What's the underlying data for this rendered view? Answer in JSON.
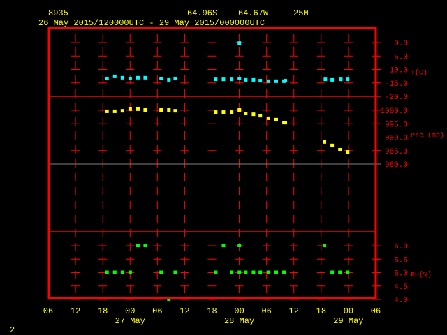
{
  "header": {
    "station": "8935",
    "lat": "64.96S",
    "lon": "64.67W",
    "elev": "25M",
    "period": "26 May 2015/120000UTC - 29 May 2015/000000UTC"
  },
  "page_number": "2",
  "colors": {
    "frame": "#ff0000",
    "text": "#ffff00",
    "temp": "#00ffff",
    "pres": "#ffff00",
    "rh": "#00ff00",
    "midline": "#808080"
  },
  "chart_data": {
    "type": "scatter",
    "x_unit": "hours since 26 May 06Z",
    "xlim": [
      0,
      72
    ],
    "x_tick_labels": [
      "06",
      "12",
      "18",
      "00",
      "06",
      "12",
      "18",
      "00",
      "06",
      "12",
      "18",
      "00",
      "06"
    ],
    "day_labels": [
      {
        "hour": 18,
        "label": "27 May"
      },
      {
        "hour": 42,
        "label": "28 May"
      },
      {
        "hour": 66,
        "label": "29 May"
      }
    ],
    "panels": [
      {
        "name": "temperature",
        "label": "T(C)",
        "ylim": [
          -20,
          0
        ],
        "ticks": [
          "0.0",
          "-5.0",
          "-10.0",
          "-15.0",
          "-20.0"
        ],
        "tick_values": [
          0,
          -5,
          -10,
          -15,
          -20
        ],
        "points": [
          [
            13,
            -13.5
          ],
          [
            14.7,
            -12.7
          ],
          [
            16.4,
            -13.2
          ],
          [
            18.1,
            -13.5
          ],
          [
            19.8,
            -13.2
          ],
          [
            21.4,
            -13.2
          ],
          [
            24.9,
            -13.5
          ],
          [
            26.6,
            -14
          ],
          [
            28,
            -13.5
          ],
          [
            36.9,
            -13.8
          ],
          [
            38.6,
            -13.8
          ],
          [
            40.4,
            -13.8
          ],
          [
            42.1,
            -13.5
          ],
          [
            42.1,
            -0.3
          ],
          [
            43.5,
            -14
          ],
          [
            45.2,
            -14
          ],
          [
            46.7,
            -14.3
          ],
          [
            48.5,
            -14.5
          ],
          [
            50.2,
            -14.5
          ],
          [
            51.9,
            -14.5
          ],
          [
            52.2,
            -14.3
          ],
          [
            61,
            -13.8
          ],
          [
            62.5,
            -14
          ],
          [
            64.4,
            -13.8
          ],
          [
            65.9,
            -13.8
          ]
        ]
      },
      {
        "name": "pressure",
        "label": "Pre (mb)",
        "ylim": [
          980,
          1000
        ],
        "ticks": [
          "1000.0",
          "995.0",
          "990.0",
          "985.0",
          "980.0"
        ],
        "tick_values": [
          1000,
          995,
          990,
          985,
          980
        ],
        "points": [
          [
            13,
            999.5
          ],
          [
            14.7,
            999.5
          ],
          [
            16.4,
            999.7
          ],
          [
            18.1,
            1000.3
          ],
          [
            19.8,
            1000.3
          ],
          [
            21.4,
            1000
          ],
          [
            24.9,
            1000
          ],
          [
            26.6,
            1000
          ],
          [
            28,
            999.7
          ],
          [
            36.9,
            999.2
          ],
          [
            38.6,
            999.2
          ],
          [
            40.4,
            999.2
          ],
          [
            42.1,
            1000
          ],
          [
            43.5,
            998.7
          ],
          [
            45.2,
            998.4
          ],
          [
            46.7,
            997.9
          ],
          [
            48.5,
            996.9
          ],
          [
            50.2,
            996.4
          ],
          [
            51.9,
            995.3
          ],
          [
            52.2,
            995.3
          ],
          [
            60.8,
            988.1
          ],
          [
            62.5,
            986.8
          ],
          [
            64.2,
            985.2
          ],
          [
            65.9,
            984.4
          ]
        ]
      },
      {
        "name": "rh",
        "label": "RH(%)",
        "ylim": [
          4,
          6
        ],
        "ticks": [
          "6.0",
          "5.5",
          "5.0",
          "4.5",
          "4.0"
        ],
        "tick_values": [
          6,
          5.5,
          5,
          4.5,
          4
        ],
        "points": [
          [
            13,
            5
          ],
          [
            14.7,
            5
          ],
          [
            16.4,
            5
          ],
          [
            18.1,
            5
          ],
          [
            19.8,
            6
          ],
          [
            21.4,
            6
          ],
          [
            24.9,
            5
          ],
          [
            26.6,
            4
          ],
          [
            28,
            5
          ],
          [
            36.9,
            5
          ],
          [
            38.6,
            6
          ],
          [
            40.4,
            5
          ],
          [
            42.1,
            6
          ],
          [
            42.1,
            5
          ],
          [
            43.5,
            5
          ],
          [
            45.2,
            5
          ],
          [
            46.7,
            5
          ],
          [
            48.5,
            5
          ],
          [
            50.2,
            5
          ],
          [
            51.9,
            5
          ],
          [
            60.8,
            6
          ],
          [
            62.5,
            5
          ],
          [
            64.2,
            5
          ],
          [
            65.9,
            5
          ]
        ]
      }
    ]
  }
}
